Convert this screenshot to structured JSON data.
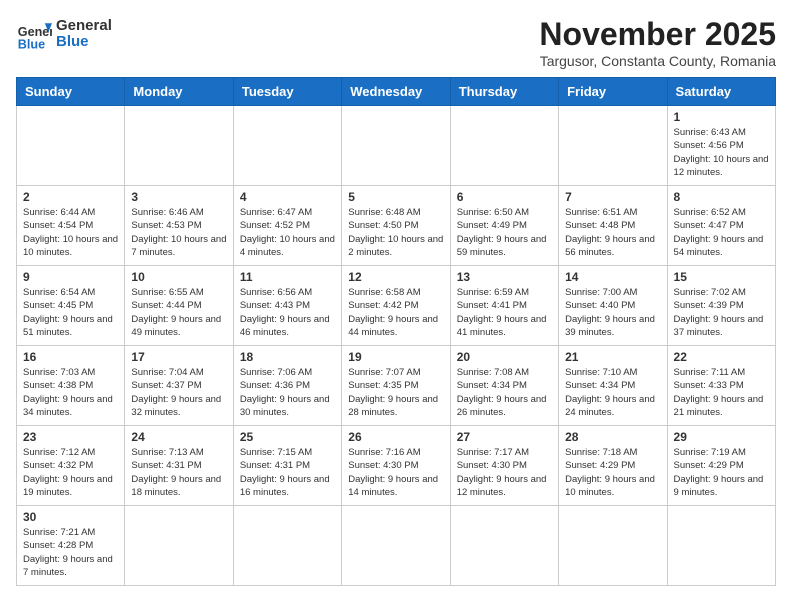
{
  "header": {
    "logo_general": "General",
    "logo_blue": "Blue",
    "month_title": "November 2025",
    "subtitle": "Targusor, Constanta County, Romania"
  },
  "days_of_week": [
    "Sunday",
    "Monday",
    "Tuesday",
    "Wednesday",
    "Thursday",
    "Friday",
    "Saturday"
  ],
  "weeks": [
    [
      {
        "day": "",
        "info": ""
      },
      {
        "day": "",
        "info": ""
      },
      {
        "day": "",
        "info": ""
      },
      {
        "day": "",
        "info": ""
      },
      {
        "day": "",
        "info": ""
      },
      {
        "day": "",
        "info": ""
      },
      {
        "day": "1",
        "info": "Sunrise: 6:43 AM\nSunset: 4:56 PM\nDaylight: 10 hours\nand 12 minutes."
      }
    ],
    [
      {
        "day": "2",
        "info": "Sunrise: 6:44 AM\nSunset: 4:54 PM\nDaylight: 10 hours\nand 10 minutes."
      },
      {
        "day": "3",
        "info": "Sunrise: 6:46 AM\nSunset: 4:53 PM\nDaylight: 10 hours\nand 7 minutes."
      },
      {
        "day": "4",
        "info": "Sunrise: 6:47 AM\nSunset: 4:52 PM\nDaylight: 10 hours\nand 4 minutes."
      },
      {
        "day": "5",
        "info": "Sunrise: 6:48 AM\nSunset: 4:50 PM\nDaylight: 10 hours\nand 2 minutes."
      },
      {
        "day": "6",
        "info": "Sunrise: 6:50 AM\nSunset: 4:49 PM\nDaylight: 9 hours\nand 59 minutes."
      },
      {
        "day": "7",
        "info": "Sunrise: 6:51 AM\nSunset: 4:48 PM\nDaylight: 9 hours\nand 56 minutes."
      },
      {
        "day": "8",
        "info": "Sunrise: 6:52 AM\nSunset: 4:47 PM\nDaylight: 9 hours\nand 54 minutes."
      }
    ],
    [
      {
        "day": "9",
        "info": "Sunrise: 6:54 AM\nSunset: 4:45 PM\nDaylight: 9 hours\nand 51 minutes."
      },
      {
        "day": "10",
        "info": "Sunrise: 6:55 AM\nSunset: 4:44 PM\nDaylight: 9 hours\nand 49 minutes."
      },
      {
        "day": "11",
        "info": "Sunrise: 6:56 AM\nSunset: 4:43 PM\nDaylight: 9 hours\nand 46 minutes."
      },
      {
        "day": "12",
        "info": "Sunrise: 6:58 AM\nSunset: 4:42 PM\nDaylight: 9 hours\nand 44 minutes."
      },
      {
        "day": "13",
        "info": "Sunrise: 6:59 AM\nSunset: 4:41 PM\nDaylight: 9 hours\nand 41 minutes."
      },
      {
        "day": "14",
        "info": "Sunrise: 7:00 AM\nSunset: 4:40 PM\nDaylight: 9 hours\nand 39 minutes."
      },
      {
        "day": "15",
        "info": "Sunrise: 7:02 AM\nSunset: 4:39 PM\nDaylight: 9 hours\nand 37 minutes."
      }
    ],
    [
      {
        "day": "16",
        "info": "Sunrise: 7:03 AM\nSunset: 4:38 PM\nDaylight: 9 hours\nand 34 minutes."
      },
      {
        "day": "17",
        "info": "Sunrise: 7:04 AM\nSunset: 4:37 PM\nDaylight: 9 hours\nand 32 minutes."
      },
      {
        "day": "18",
        "info": "Sunrise: 7:06 AM\nSunset: 4:36 PM\nDaylight: 9 hours\nand 30 minutes."
      },
      {
        "day": "19",
        "info": "Sunrise: 7:07 AM\nSunset: 4:35 PM\nDaylight: 9 hours\nand 28 minutes."
      },
      {
        "day": "20",
        "info": "Sunrise: 7:08 AM\nSunset: 4:34 PM\nDaylight: 9 hours\nand 26 minutes."
      },
      {
        "day": "21",
        "info": "Sunrise: 7:10 AM\nSunset: 4:34 PM\nDaylight: 9 hours\nand 24 minutes."
      },
      {
        "day": "22",
        "info": "Sunrise: 7:11 AM\nSunset: 4:33 PM\nDaylight: 9 hours\nand 21 minutes."
      }
    ],
    [
      {
        "day": "23",
        "info": "Sunrise: 7:12 AM\nSunset: 4:32 PM\nDaylight: 9 hours\nand 19 minutes."
      },
      {
        "day": "24",
        "info": "Sunrise: 7:13 AM\nSunset: 4:31 PM\nDaylight: 9 hours\nand 18 minutes."
      },
      {
        "day": "25",
        "info": "Sunrise: 7:15 AM\nSunset: 4:31 PM\nDaylight: 9 hours\nand 16 minutes."
      },
      {
        "day": "26",
        "info": "Sunrise: 7:16 AM\nSunset: 4:30 PM\nDaylight: 9 hours\nand 14 minutes."
      },
      {
        "day": "27",
        "info": "Sunrise: 7:17 AM\nSunset: 4:30 PM\nDaylight: 9 hours\nand 12 minutes."
      },
      {
        "day": "28",
        "info": "Sunrise: 7:18 AM\nSunset: 4:29 PM\nDaylight: 9 hours\nand 10 minutes."
      },
      {
        "day": "29",
        "info": "Sunrise: 7:19 AM\nSunset: 4:29 PM\nDaylight: 9 hours\nand 9 minutes."
      }
    ],
    [
      {
        "day": "30",
        "info": "Sunrise: 7:21 AM\nSunset: 4:28 PM\nDaylight: 9 hours\nand 7 minutes."
      },
      {
        "day": "",
        "info": ""
      },
      {
        "day": "",
        "info": ""
      },
      {
        "day": "",
        "info": ""
      },
      {
        "day": "",
        "info": ""
      },
      {
        "day": "",
        "info": ""
      },
      {
        "day": "",
        "info": ""
      }
    ]
  ]
}
